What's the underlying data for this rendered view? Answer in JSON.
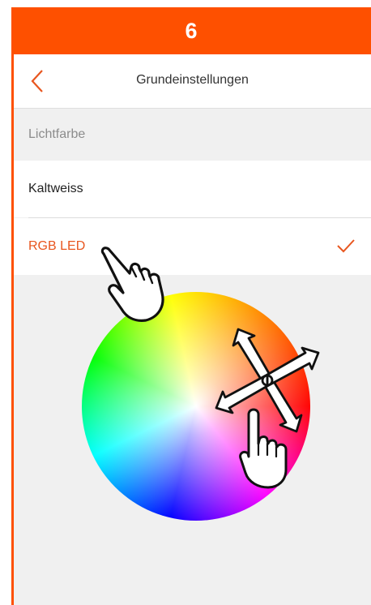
{
  "step": {
    "number": "6"
  },
  "nav": {
    "title": "Grundeinstellungen"
  },
  "section": {
    "label": "Lichtfarbe"
  },
  "options": [
    {
      "label": "Kaltweiss",
      "selected": false
    },
    {
      "label": "RGB LED",
      "selected": true
    }
  ],
  "icons": {
    "back": "chevron-left-icon",
    "check": "checkmark-icon",
    "tap_hand": "pointing-hand-icon",
    "drag": "four-way-arrow-icon"
  },
  "colors": {
    "accent": "#fe5000",
    "selected_text": "#e8561f",
    "background": "#f0f0f0"
  }
}
